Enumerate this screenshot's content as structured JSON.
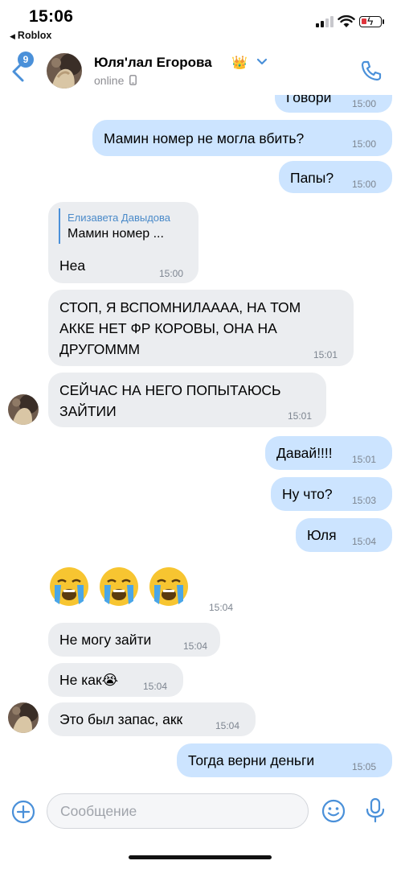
{
  "status": {
    "time": "15:06",
    "back_app": "Roblox"
  },
  "header": {
    "unread_count": "9",
    "contact_name": "Юля'лал Егорова",
    "crown": "👑",
    "presence": "online"
  },
  "messages": [
    {
      "dir": "out",
      "text": "Говори",
      "time": "15:00"
    },
    {
      "dir": "out",
      "text": "Мамин номер не могла вбить?",
      "time": "15:00"
    },
    {
      "dir": "out",
      "text": "Папы?",
      "time": "15:00"
    },
    {
      "dir": "in",
      "reply_name": "Елизавета Давыдова",
      "reply_text": "Мамин номер ...",
      "text": "Неа",
      "time": "15:00"
    },
    {
      "dir": "in",
      "lines": [
        "СТОП, Я ВСПОМНИЛАААА, НА ТОМ",
        "АККЕ НЕТ ФР КОРОВЫ, ОНА НА",
        "ДРУГОМММ"
      ],
      "time": "15:01"
    },
    {
      "dir": "in",
      "lines": [
        "СЕЙЧАС НА НЕГО ПОПЫТАЮСЬ",
        "ЗАЙТИИ"
      ],
      "time": "15:01"
    },
    {
      "dir": "out",
      "text": "Давай!!!!",
      "time": "15:01"
    },
    {
      "dir": "out",
      "text": "Ну что?",
      "time": "15:03"
    },
    {
      "dir": "out",
      "text": "Юля",
      "time": "15:04"
    },
    {
      "dir": "in",
      "emoji": "😭😭😭",
      "time": "15:04"
    },
    {
      "dir": "in",
      "text": "Не могу зайти",
      "time": "15:04"
    },
    {
      "dir": "in",
      "text": "Не как😭",
      "time": "15:04"
    },
    {
      "dir": "in",
      "text": "Это был запас, акк",
      "time": "15:04"
    },
    {
      "dir": "out",
      "text": "Тогда верни деньги",
      "time": "15:05"
    }
  ],
  "composer": {
    "placeholder": "Сообщение"
  },
  "colors": {
    "accent": "#4a90d9",
    "outgoing": "#cce4ff",
    "incoming": "#ebedf0"
  }
}
